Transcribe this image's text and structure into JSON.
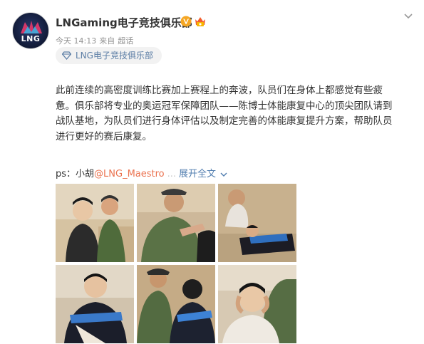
{
  "post": {
    "username": "LNGaming电子竞技俱乐部",
    "avatar_text": "LNG",
    "timestamp": "今天 14:13",
    "source_prefix": "来自",
    "source": "超话",
    "group_tag": "LNG电子竞技俱乐部",
    "body_lines": [
      "此前连续的高密度训练比赛加上赛程上的奔波，队员们在身体上都感觉有些疲",
      "惫。俱乐部将专业的奥运冠军保障团队——陈博士体能康复中心的顶尖团队请到",
      "战队基地，为队员们进行身体评估以及制定完善的体能康复提升方案，帮助队员",
      "进行更好的赛后康复。"
    ],
    "ps_prefix": "ps：小胡",
    "ps_mention": "@LNG_Maestro",
    "expand_label": "展开全文",
    "icons": {
      "verified": "verified-v-icon",
      "vip": "vip-member-icon",
      "more": "chevron-down-icon",
      "group": "diamond-icon"
    },
    "colors": {
      "verified": "#f5a623",
      "vip": "#f35c2c",
      "link": "#507daf",
      "mention": "#eb7350",
      "muted": "#939393"
    },
    "photos": [
      {
        "alt": "player-with-trainer-1"
      },
      {
        "alt": "trainer-treating-arm"
      },
      {
        "alt": "player-lying-on-table"
      },
      {
        "alt": "player-with-bandaged-arm"
      },
      {
        "alt": "trainer-treating-back"
      },
      {
        "alt": "trainer-adjusting-neck"
      }
    ]
  }
}
